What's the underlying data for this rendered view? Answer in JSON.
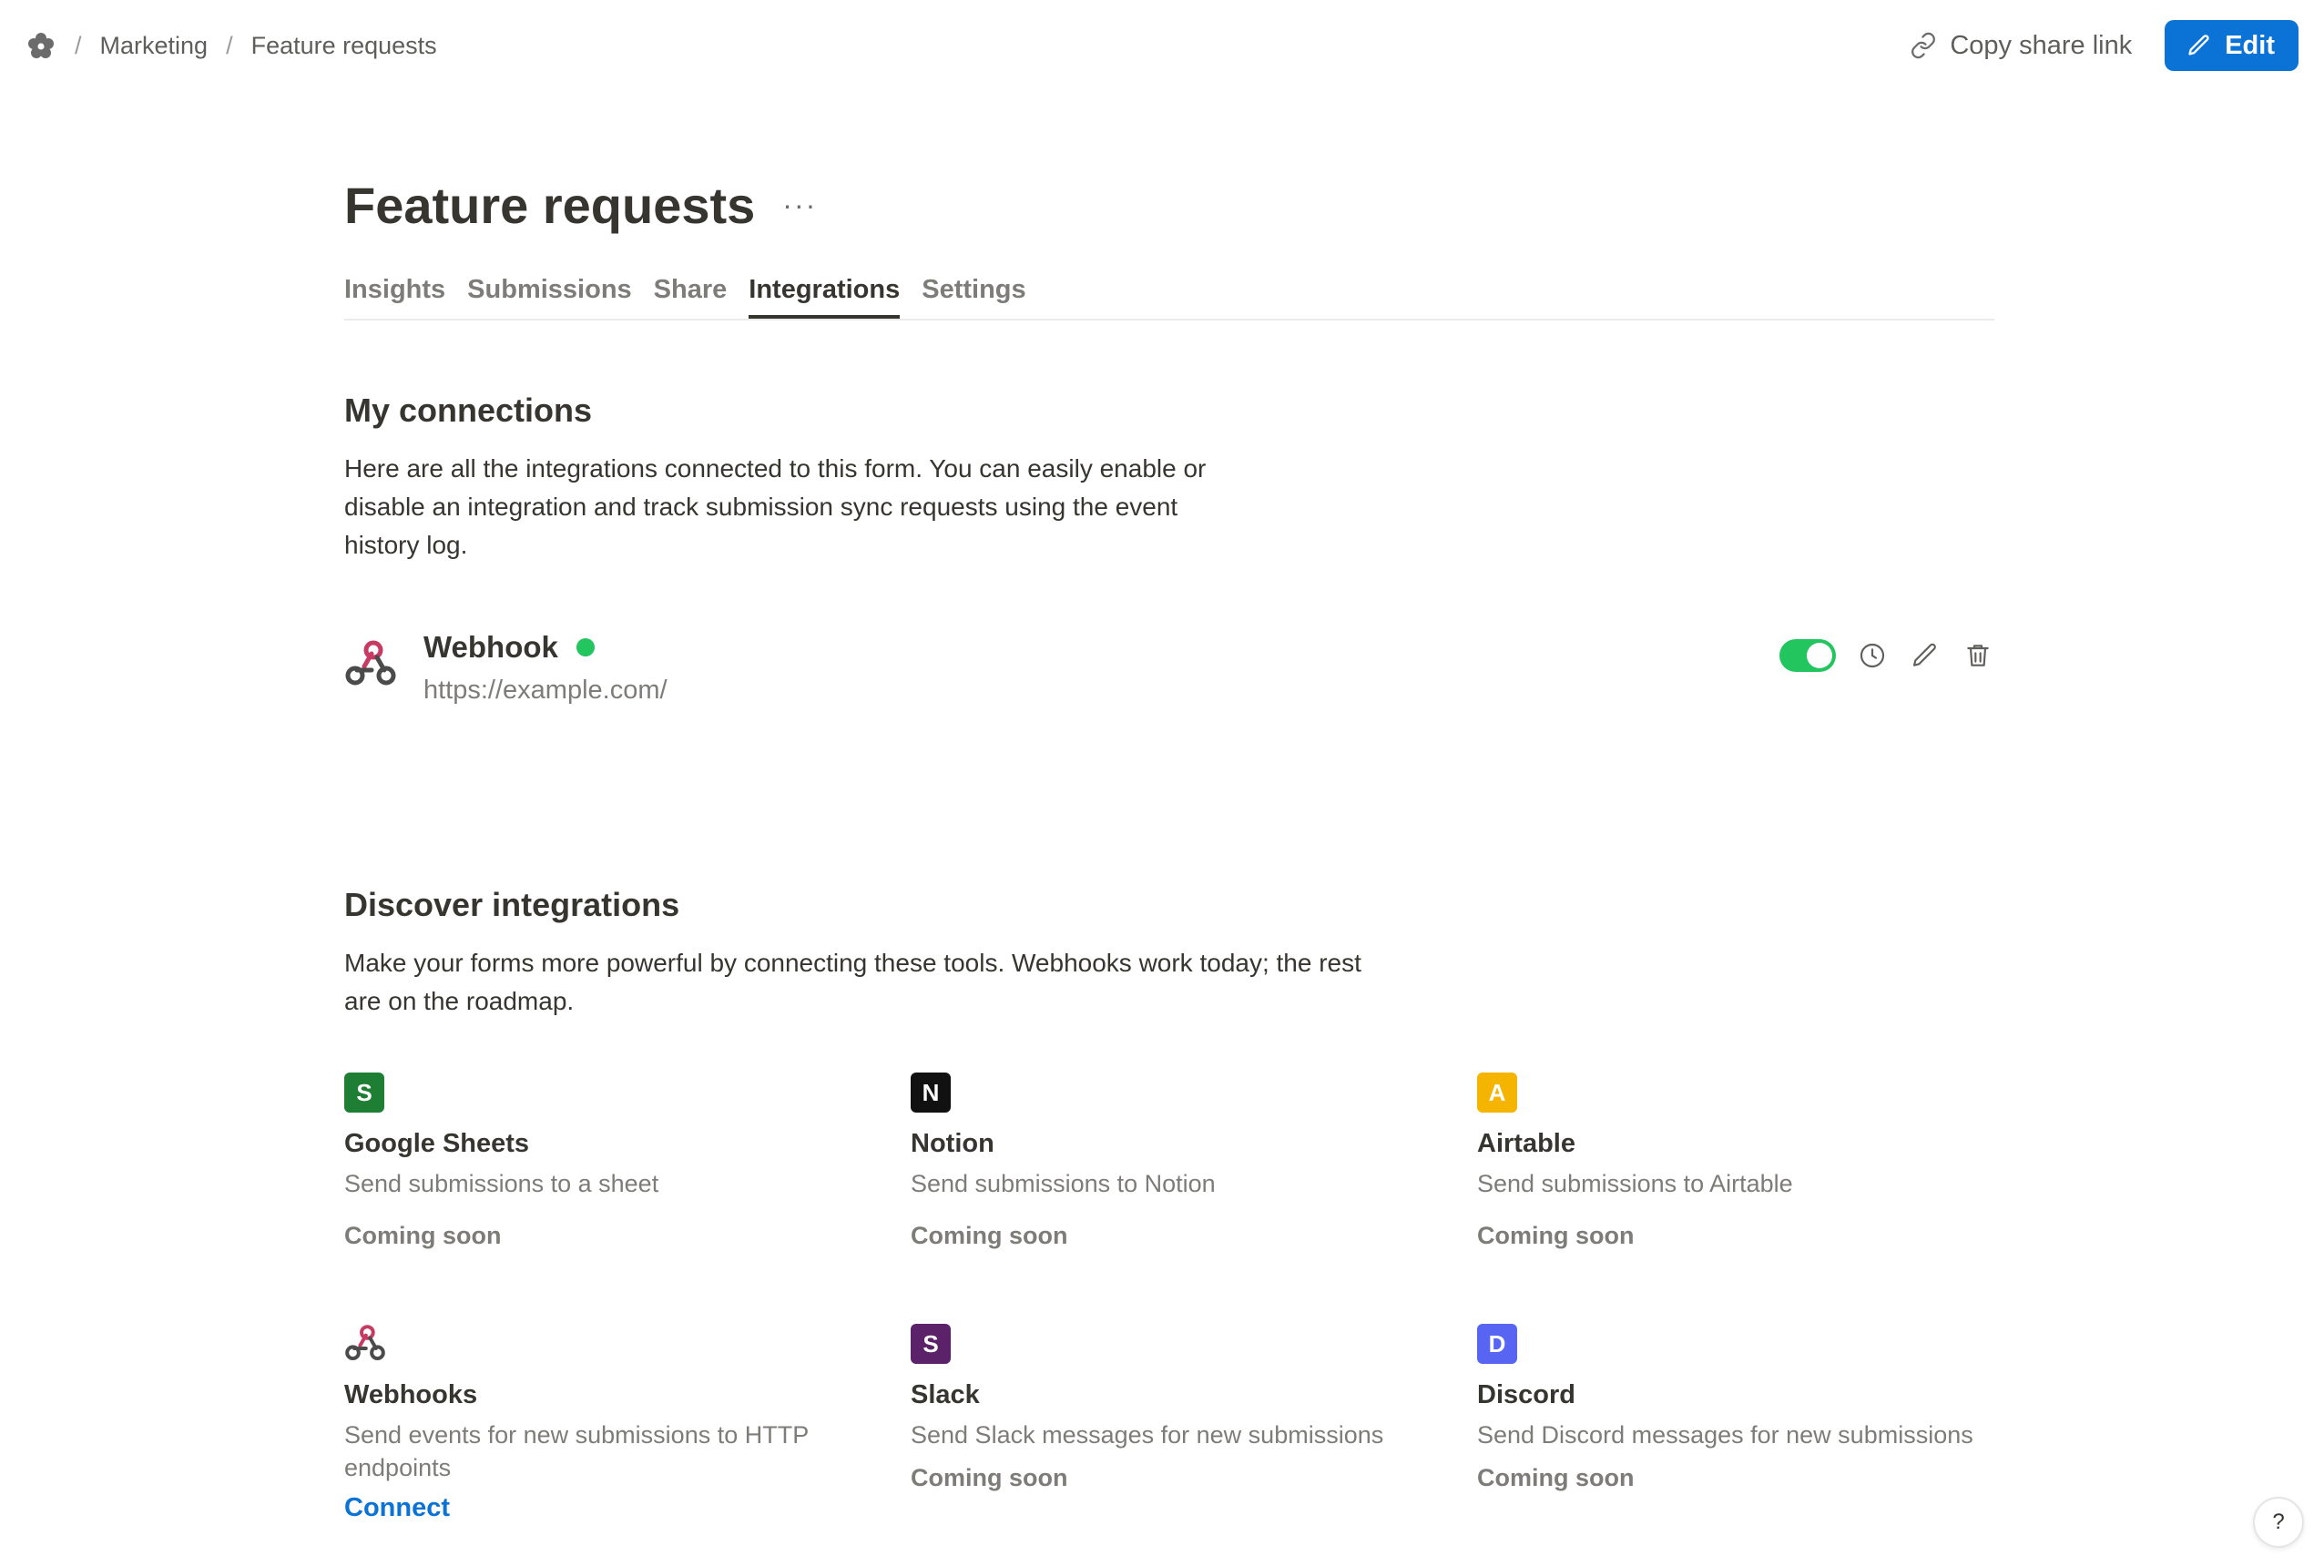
{
  "breadcrumb": {
    "separator": "/",
    "workspace": "Marketing",
    "current": "Feature requests"
  },
  "header": {
    "copy_link_label": "Copy share link",
    "edit_label": "Edit"
  },
  "page": {
    "title": "Feature requests",
    "more_label": "···"
  },
  "tabs": [
    {
      "label": "Insights",
      "active": false
    },
    {
      "label": "Submissions",
      "active": false
    },
    {
      "label": "Share",
      "active": false
    },
    {
      "label": "Integrations",
      "active": true
    },
    {
      "label": "Settings",
      "active": false
    }
  ],
  "connections": {
    "title": "My connections",
    "description": "Here are all the integrations connected to this form. You can easily enable or disable an integration and track submission sync requests using the event history log.",
    "items": [
      {
        "name": "Webhook",
        "url": "https://example.com/",
        "enabled": true,
        "status_color": "#22c55e"
      }
    ]
  },
  "discover": {
    "title": "Discover integrations",
    "description": "Make your forms more powerful by connecting these tools. Webhooks work today; the rest are on the roadmap.",
    "items": [
      {
        "badge": "S",
        "badge_color": "#1e7e34",
        "name": "Google Sheets",
        "description": "Send submissions to a sheet",
        "status": "Coming soon"
      },
      {
        "badge": "N",
        "badge_color": "#111111",
        "name": "Notion",
        "description": "Send submissions to Notion",
        "status": "Coming soon"
      },
      {
        "badge": "A",
        "badge_color": "#f4b400",
        "name": "Airtable",
        "description": "Send submissions to Airtable",
        "status": "Coming soon"
      },
      {
        "icon": "webhook-icon",
        "name": "Webhooks",
        "description": "Send events for new submissions to HTTP endpoints",
        "action": "Connect"
      },
      {
        "badge": "S",
        "badge_color": "#5b2169",
        "name": "Slack",
        "description": "Send Slack messages for new submissions",
        "status": "Coming soon"
      },
      {
        "badge": "D",
        "badge_color": "#5865f2",
        "name": "Discord",
        "description": "Send Discord messages for new submissions",
        "status": "Coming soon"
      }
    ]
  },
  "help": {
    "label": "?"
  },
  "colors": {
    "accent": "#0b72d6",
    "enabled": "#22c55e",
    "text": "#37352f",
    "muted": "#7d7c78"
  }
}
